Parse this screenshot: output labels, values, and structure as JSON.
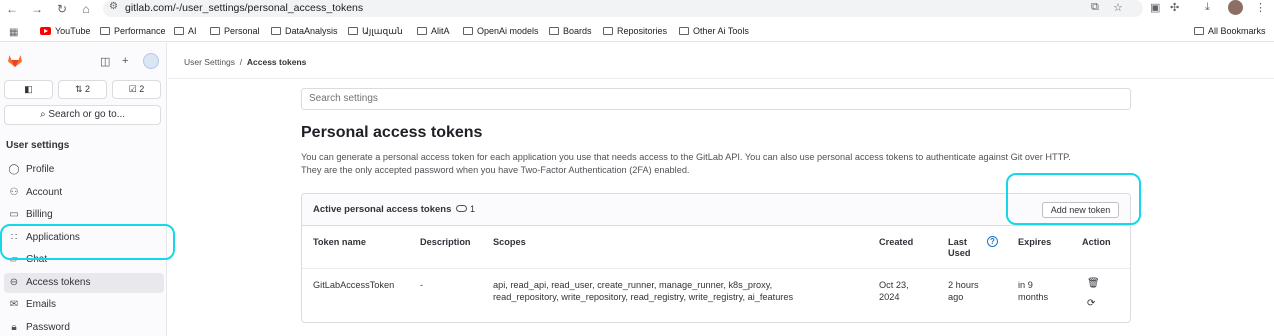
{
  "browser": {
    "url": "gitlab.com/-/user_settings/personal_access_tokens",
    "bookmarks": [
      "YouTube",
      "Performance",
      "AI",
      "Personal",
      "DataAnalysis",
      "Այլազան",
      "AlitA",
      "OpenAi models",
      "Boards",
      "Repositories",
      "Other Ai Tools"
    ],
    "all_bookmarks": "All Bookmarks"
  },
  "sidebar": {
    "merge_count": "2",
    "todo_count": "2",
    "search_label": "Search or go to...",
    "section_title": "User settings",
    "items": [
      {
        "label": "Profile",
        "icon": "user-icon"
      },
      {
        "label": "Account",
        "icon": "account-icon"
      },
      {
        "label": "Billing",
        "icon": "billing-icon"
      },
      {
        "label": "Applications",
        "icon": "applications-icon"
      },
      {
        "label": "Chat",
        "icon": "chat-icon"
      },
      {
        "label": "Access tokens",
        "icon": "token-icon"
      },
      {
        "label": "Emails",
        "icon": "mail-icon"
      },
      {
        "label": "Password",
        "icon": "lock-icon"
      }
    ]
  },
  "breadcrumb": {
    "parent": "User Settings",
    "separator": "/",
    "current": "Access tokens"
  },
  "search": {
    "placeholder": "Search settings"
  },
  "page": {
    "title": "Personal access tokens",
    "description_line1": "You can generate a personal access token for each application you use that needs access to the GitLab API. You can also use personal access tokens to authenticate against Git over HTTP.",
    "description_line2": "They are the only accepted password when you have Two-Factor Authentication (2FA) enabled."
  },
  "tokens_card": {
    "title": "Active personal access tokens",
    "count": "1",
    "add_button": "Add new token",
    "columns": {
      "name": "Token name",
      "description": "Description",
      "scopes": "Scopes",
      "created": "Created",
      "last_used_1": "Last",
      "last_used_2": "Used",
      "expires": "Expires",
      "action": "Action"
    },
    "rows": [
      {
        "name": "GitLabAccessToken",
        "description": "-",
        "scopes_line1": "api, read_api, read_user, create_runner, manage_runner, k8s_proxy,",
        "scopes_line2": "read_repository, write_repository, read_registry, write_registry, ai_features",
        "created_1": "Oct 23,",
        "created_2": "2024",
        "last_used_1": "2 hours",
        "last_used_2": "ago",
        "expires_1": "in 9",
        "expires_2": "months"
      }
    ]
  },
  "colors": {
    "highlight": "#15d6ea",
    "accent": "#1f75cb"
  }
}
